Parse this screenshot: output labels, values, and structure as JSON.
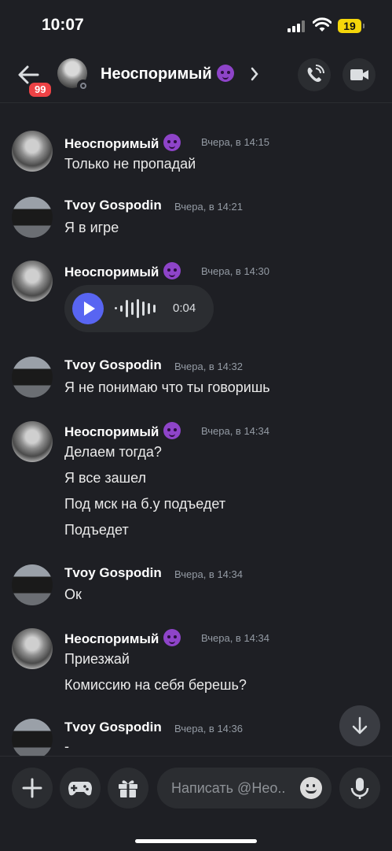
{
  "status_bar": {
    "time": "10:07",
    "battery": "19"
  },
  "header": {
    "unread_count": "99",
    "contact_name": "Неоспоримый",
    "icons": [
      "back-arrow-icon",
      "status-offline-icon",
      "chevron-right-icon",
      "phone-call-icon",
      "video-camera-icon"
    ]
  },
  "messages": [
    {
      "author": "Неоспоримый",
      "timestamp": "Вчера, в 14:15",
      "lines": [
        "Только не пропадай"
      ]
    },
    {
      "author": "Tvoy Gospodin",
      "timestamp": "Вчера, в 14:21",
      "lines": [
        "Я в игре"
      ]
    },
    {
      "author": "Неоспоримый",
      "timestamp": "Вчера, в 14:30",
      "voice_duration": "0:04"
    },
    {
      "author": "Tvoy Gospodin",
      "timestamp": "Вчера, в 14:32",
      "lines": [
        "Я не понимаю что ты говоришь"
      ]
    },
    {
      "author": "Неоспоримый",
      "timestamp": "Вчера, в 14:34",
      "lines": [
        "Делаем тогда?",
        "Я все зашел",
        "Под мск на б.у подъедет",
        "Подъедет"
      ]
    },
    {
      "author": "Tvoy Gospodin",
      "timestamp": "Вчера, в 14:34",
      "lines": [
        "Ок"
      ]
    },
    {
      "author": "Неоспоримый",
      "timestamp": "Вчера, в 14:34",
      "lines": [
        "Приезжай",
        "Комиссию на себя берешь?"
      ]
    },
    {
      "author": "Tvoy Gospodin",
      "timestamp": "Вчера, в 14:36",
      "lines": [
        "-"
      ]
    }
  ],
  "composer": {
    "placeholder": "Написать @Нео..",
    "icons": [
      "plus-icon",
      "gamepad-icon",
      "gift-icon",
      "emoji-icon",
      "microphone-icon"
    ]
  },
  "colors": {
    "background": "#1e1f24",
    "surface": "#2b2d31",
    "accent": "#5865f2",
    "badge": "#ed4245"
  }
}
